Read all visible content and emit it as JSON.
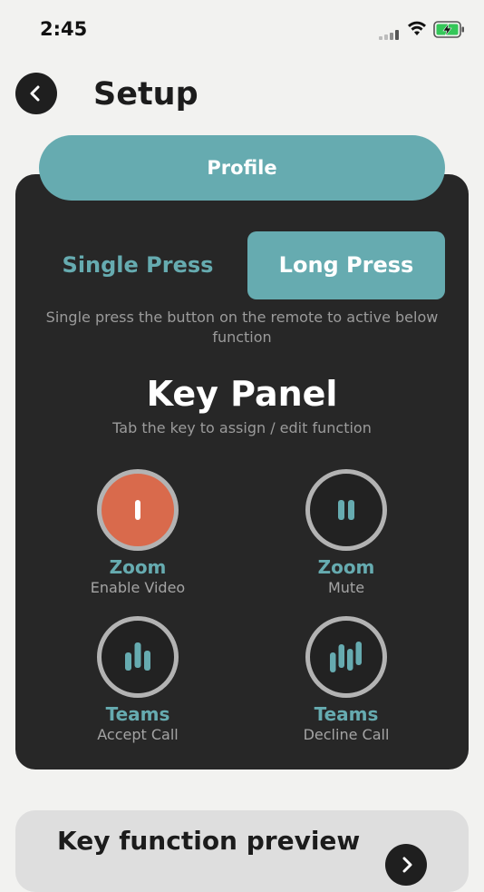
{
  "status_bar": {
    "time": "2:45"
  },
  "header": {
    "title": "Setup",
    "back_icon": "chevron-left-icon"
  },
  "tabs": {
    "profile_label": "Profile"
  },
  "press_mode": {
    "single_label": "Single Press",
    "long_label": "Long Press",
    "selected": "Long Press",
    "description": "Single press the button on the remote to active below function"
  },
  "key_panel": {
    "title": "Key Panel",
    "subtitle": "Tab the key to assign / edit function",
    "keys": [
      {
        "app": "Zoom",
        "function": "Enable Video",
        "icon": "single-bar-icon",
        "active": true
      },
      {
        "app": "Zoom",
        "function": "Mute",
        "icon": "double-bar-icon",
        "active": false
      },
      {
        "app": "Teams",
        "function": "Accept Call",
        "icon": "triple-bar-icon",
        "active": false
      },
      {
        "app": "Teams",
        "function": "Decline Call",
        "icon": "quad-bar-icon",
        "active": false
      }
    ]
  },
  "preview": {
    "title": "Key function preview",
    "arrow_icon": "chevron-right-icon"
  },
  "colors": {
    "accent": "#66abb0",
    "active_key": "#d96a4c",
    "card": "#272727",
    "background": "#f2f2f0"
  }
}
